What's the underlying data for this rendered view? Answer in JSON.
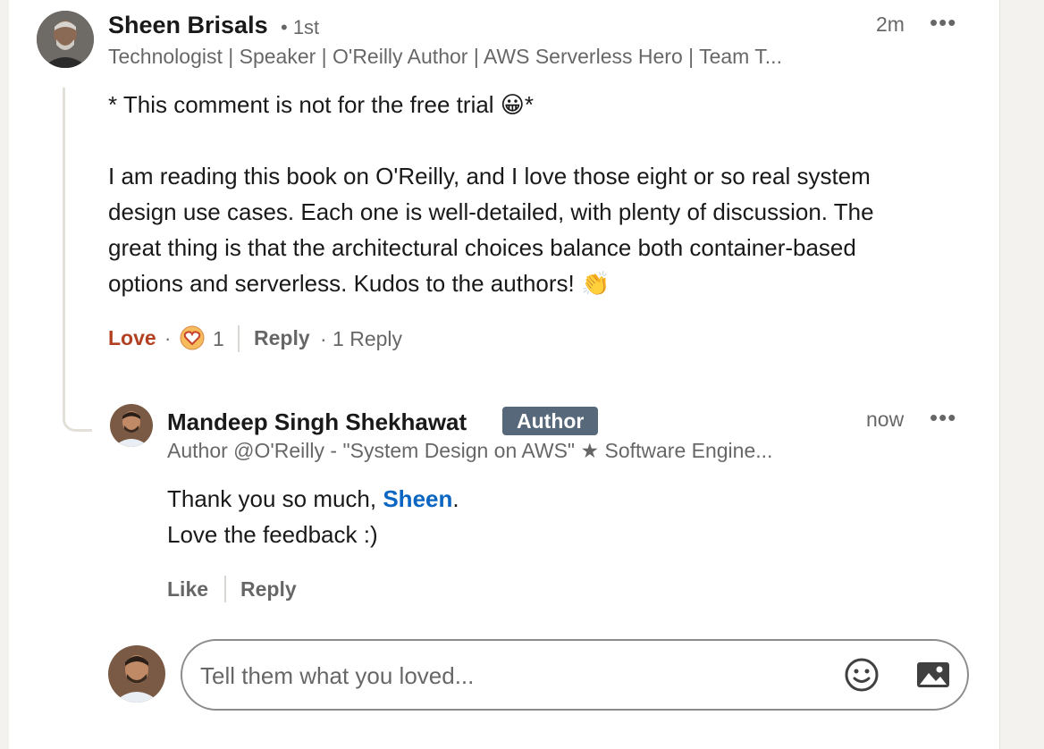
{
  "comment": {
    "author_name": "Sheen Brisals",
    "degree": "• 1st",
    "headline": "Technologist | Speaker | O'Reilly Author | AWS Serverless Hero | Team T...",
    "time": "2m",
    "more_icon": "ellipsis-icon",
    "text_line1": "* This comment is not for the free trial 😀*",
    "text_body": "I am reading this book on O'Reilly, and I love those eight or so real system\ndesign use cases. Each one is well-detailed, with plenty of discussion. The\ngreat thing is that the architectural choices balance both container-based\noptions and serverless. Kudos to the authors! 👏",
    "reaction_label": "Love",
    "reaction_dot": "·",
    "reaction_count": "1",
    "reply_label": "Reply",
    "reply_count_text": "· 1 Reply",
    "reaction_color": "#b24020"
  },
  "reply": {
    "author_name": "Mandeep Singh Shekhawat",
    "badge": "Author",
    "headline": "Author @O'Reilly - \"System Design on AWS\" ★ Software Engine...",
    "time": "now",
    "text_prefix": "Thank you so much, ",
    "mention": "Sheen",
    "text_suffix": ".",
    "text_line2": "Love the feedback :)",
    "like_label": "Like",
    "reply_label": "Reply",
    "mention_color": "#0a66c2"
  },
  "composer": {
    "placeholder": "Tell them what you loved...",
    "emoji_icon": "smiley-icon",
    "image_icon": "image-icon"
  }
}
